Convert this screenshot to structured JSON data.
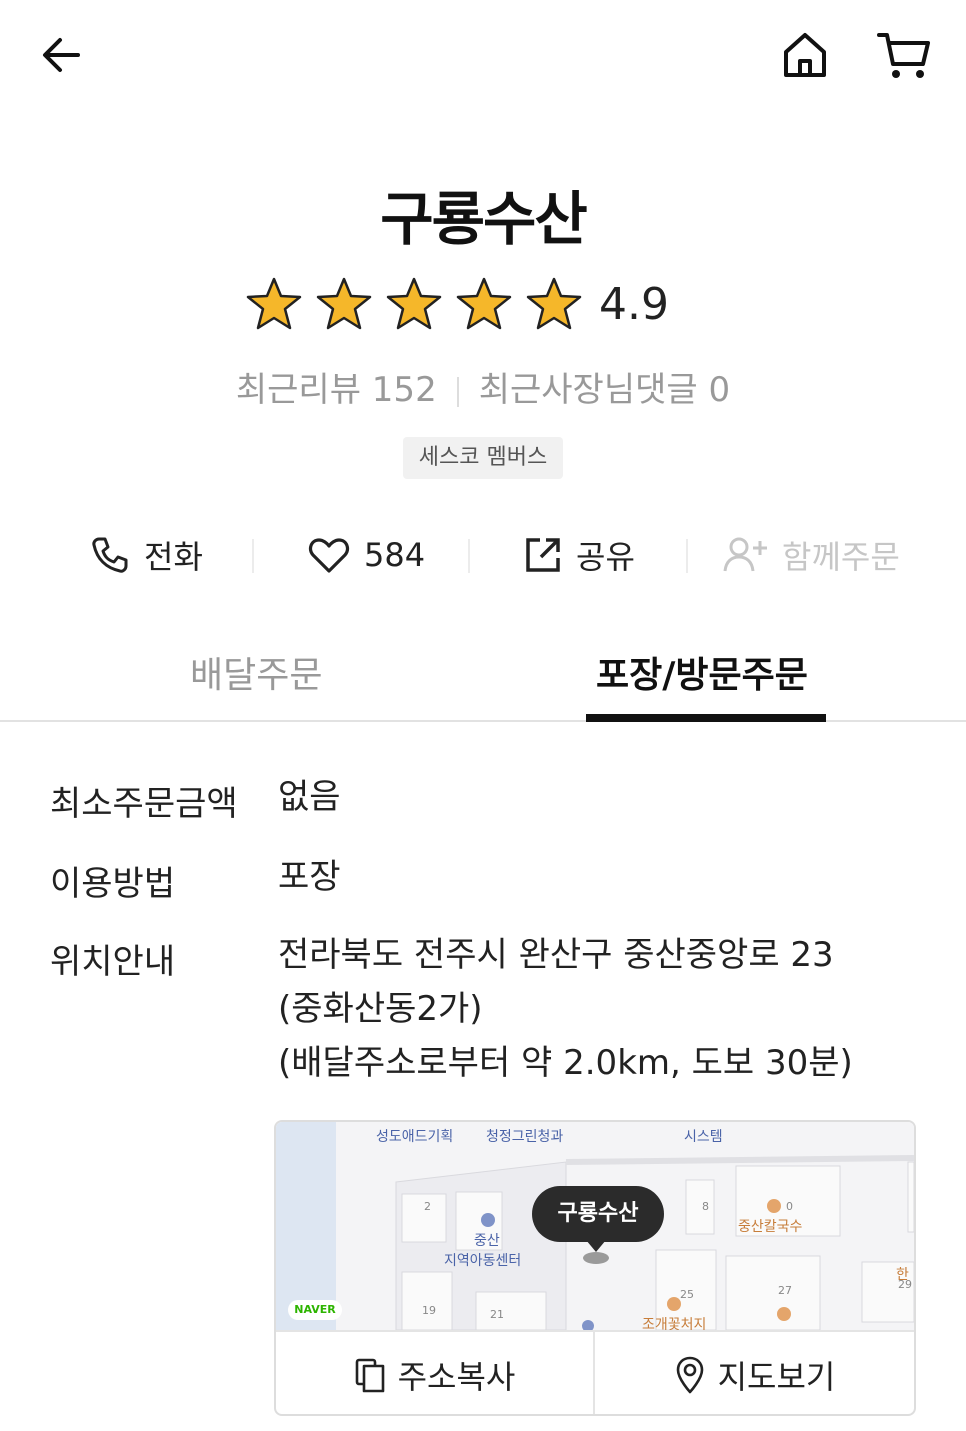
{
  "header": {
    "back_icon": "arrow-left-icon",
    "home_icon": "home-icon",
    "cart_icon": "cart-icon"
  },
  "store": {
    "name": "구룡수산",
    "rating": "4.9",
    "stars": 5,
    "star_color": "#f5b72a",
    "recent_reviews_label": "최근리뷰 152",
    "recent_replies_label": "최근사장님댓글 0",
    "badge": "세스코 멤버스"
  },
  "actions": {
    "call": "전화",
    "likes": "584",
    "share": "공유",
    "group_order": "함께주문"
  },
  "tabs": {
    "delivery": "배달주문",
    "pickup": "포장/방문주문",
    "active": "pickup"
  },
  "info": {
    "min_order_label": "최소주문금액",
    "min_order_value": "없음",
    "usage_label": "이용방법",
    "usage_value": "포장",
    "location_label": "위치안내",
    "address_line1": "전라북도 전주시 완산구 중산중앙로 23",
    "address_line2": "(중화산동2가)",
    "distance_line": "(배달주소로부터 약 2.0km, 도보 30분)"
  },
  "map": {
    "pin_label": "구룡수산",
    "naver_logo": "NAVER",
    "labels": {
      "sungdo": "성도애드기획",
      "cheongjeong": "청정그린청과",
      "system": "시스템",
      "jungsan": "중산",
      "center": "지역아동센터",
      "kalguksu": "중산칼국수",
      "jogae": "조개꽃처지",
      "han": "한"
    },
    "numbers": {
      "n2": "2",
      "n8": "8",
      "n10": "0",
      "n19": "19",
      "n21": "21",
      "n25": "25",
      "n27": "27",
      "n29": "29"
    },
    "copy_address": "주소복사",
    "view_map": "지도보기"
  }
}
